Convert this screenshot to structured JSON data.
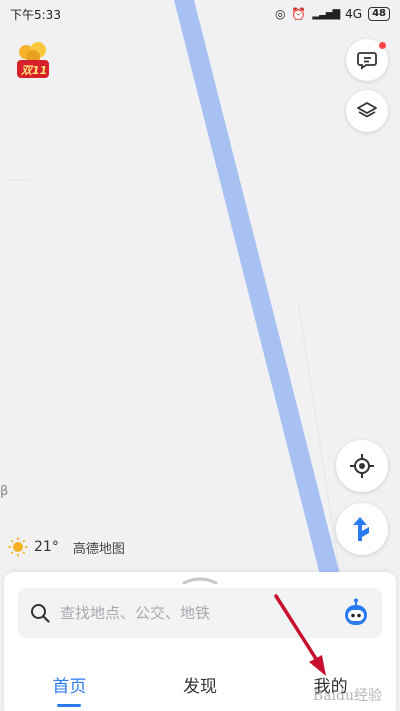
{
  "status_bar": {
    "time": "下午5:33",
    "network": "4G",
    "battery": "48"
  },
  "map": {
    "road_color": "#a7c1f3",
    "background_color": "#f1f1f3",
    "edge_letter": "β"
  },
  "promo": {
    "label": "双11",
    "icon": "gift-badge-icon"
  },
  "weather": {
    "temperature": "21°",
    "brand": "高德地图",
    "icon": "sun-icon"
  },
  "search": {
    "placeholder": "查找地点、公交、地铁",
    "value": ""
  },
  "tabs": [
    {
      "label": "首页",
      "active": true
    },
    {
      "label": "发现",
      "active": false
    },
    {
      "label": "我的",
      "active": false
    }
  ],
  "watermark": "Baidu经验",
  "colors": {
    "accent": "#2b7bf0",
    "notification_dot": "#ff4444",
    "annotation_arrow": "#c8102e"
  }
}
